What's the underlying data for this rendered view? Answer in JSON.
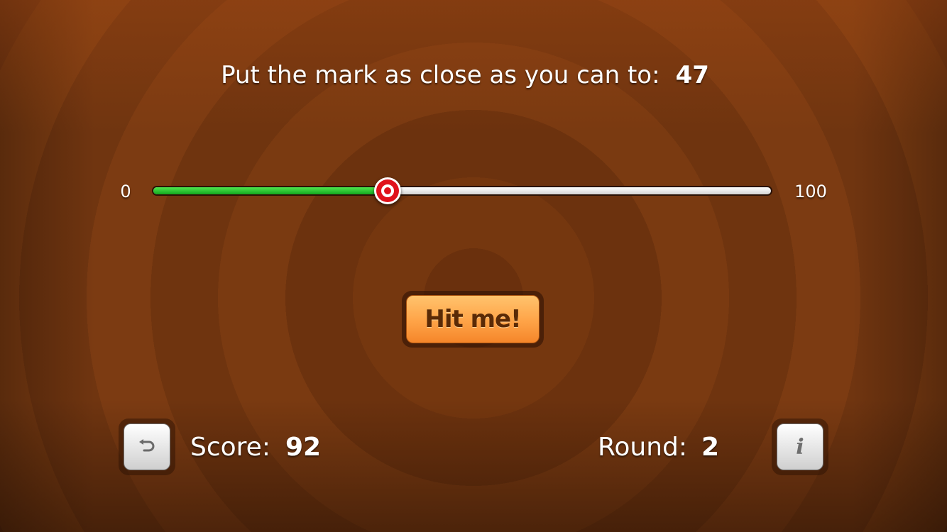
{
  "game": {
    "prompt_label": "Put the mark as close as you can to:",
    "target_value": "47"
  },
  "slider": {
    "min_label": "0",
    "max_label": "100",
    "min": 0,
    "max": 100,
    "value": 38,
    "min_track_color": "#2ecc40",
    "max_track_color": "#e6e6e6",
    "thumb_icon": "target-icon"
  },
  "hit_button": {
    "label": "Hit me!",
    "color": "#ffa64a"
  },
  "start_over_button": {
    "icon": "undo-arrow-icon"
  },
  "info_button": {
    "icon": "info-icon",
    "glyph": "i"
  },
  "score": {
    "label": "Score:",
    "value": "92"
  },
  "round": {
    "label": "Round:",
    "value": "2"
  }
}
